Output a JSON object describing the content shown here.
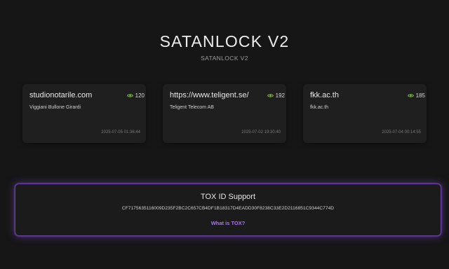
{
  "header": {
    "title": "SATANLOCK V2",
    "subtitle": "SATANLOCK V2"
  },
  "cards": [
    {
      "domain": "studionotarile.com",
      "company": "Viggiani Bullone Girardi",
      "views": "120",
      "date": "2025-07-05 01:36:44"
    },
    {
      "domain": "https://www.teligent.se/",
      "company": "Teligent Telecom AB",
      "views": "192",
      "date": "2025-07-02 19:30:40"
    },
    {
      "domain": "fkk.ac.th",
      "company": "fkk.ac.th",
      "views": "185",
      "date": "2025-07-04 00:14:55"
    }
  ],
  "tox": {
    "title": "TOX ID Support",
    "id": "CF7175635116009D235F2BC2C657CB4DF1B18317D4EADD30F8238C33E2D2116851C9344C774D",
    "link_label": "What is TOX?"
  },
  "colors": {
    "background": "#161616",
    "card": "#1f1f1f",
    "eye_icon": "#7ec832",
    "accent_purple": "#a878e8",
    "glow_border": "#6b3fa7"
  },
  "icons": {
    "views": "eye-icon"
  }
}
